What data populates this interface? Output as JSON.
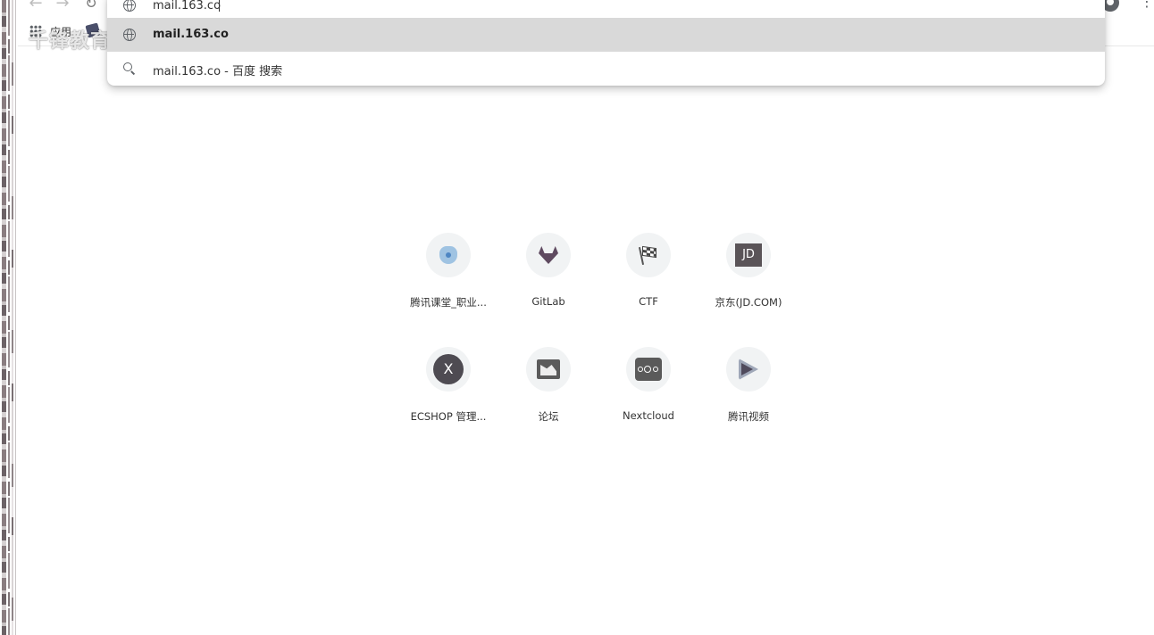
{
  "toolbar": {
    "back_icon": "arrow-left-icon",
    "forward_icon": "arrow-right-icon",
    "reload_icon": "reload-icon",
    "profile_icon": "account-circle-icon",
    "menu_icon": "more-vert-icon"
  },
  "bookmarks": {
    "apps_label": "应用"
  },
  "watermark": "千锋教育 扣丁学堂",
  "omnibox": {
    "value": "mail.163.co",
    "suggestions": [
      {
        "text": "mail.163.co",
        "icon": "globe-icon",
        "highlighted": true
      },
      {
        "text": "mail.163.co - 百度 搜索",
        "icon": "search-icon",
        "highlighted": false
      }
    ]
  },
  "tiles": [
    {
      "label": "腾讯课堂_职业...",
      "icon": "tencent-classroom-icon"
    },
    {
      "label": "GitLab",
      "icon": "gitlab-icon"
    },
    {
      "label": "CTF",
      "icon": "checkered-flag-icon"
    },
    {
      "label": "京东(JD.COM)",
      "icon": "jd-icon",
      "icon_text": "JD"
    },
    {
      "label": "ECSHOP 管理...",
      "icon": "ecshop-icon",
      "icon_text": "X"
    },
    {
      "label": "论坛",
      "icon": "forum-icon"
    },
    {
      "label": "Nextcloud",
      "icon": "nextcloud-icon"
    },
    {
      "label": "腾讯视频",
      "icon": "tencent-video-icon"
    }
  ],
  "colors": {
    "highlight_row": "#d9d9d9",
    "tile_background": "#f1f3f4",
    "icon_grey": "#5f6368"
  }
}
